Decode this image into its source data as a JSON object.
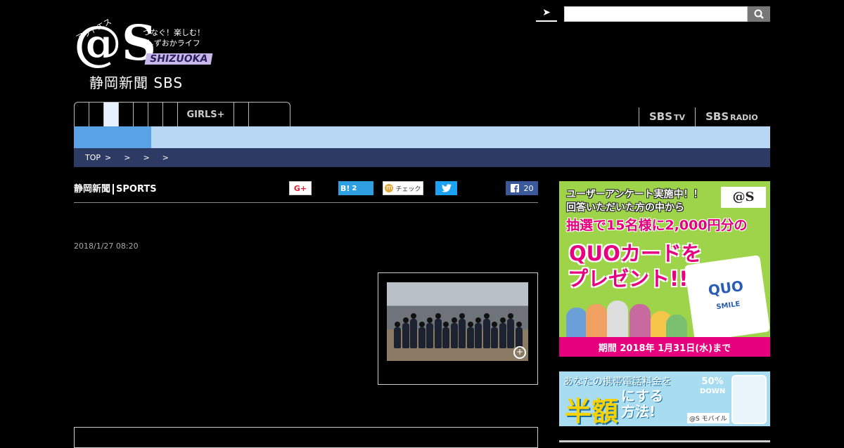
{
  "logo": {
    "kana": "アットエス",
    "mark": "@S",
    "tagline1": "つなぐ！楽しむ！",
    "tagline2": "しずおかライフ",
    "region": "SHIZUOKA",
    "brand": "静岡新聞 SBS"
  },
  "search": {
    "go_icon": "arrow-right-icon",
    "value": "",
    "button_icon": "search-icon"
  },
  "nav": {
    "tabs": [
      "",
      "",
      "",
      "",
      "",
      "",
      "",
      "GIRLS+",
      "",
      ""
    ],
    "active_index": 2
  },
  "external_links": [
    {
      "main": "SBS",
      "sub": "TV"
    },
    {
      "main": "SBS",
      "sub": "RADIO"
    }
  ],
  "breadcrumb": [
    "TOP",
    ">",
    ">",
    ">",
    ">"
  ],
  "article": {
    "source_logo": "静岡新聞",
    "source_section": "SPORTS",
    "date": "2018/1/27 08:20"
  },
  "share": {
    "gplus": "G+",
    "hatena": "B!",
    "hatena_count": "2",
    "mixi_icon": "m",
    "mixi": "チェック",
    "twitter_icon": "twitter-bird-icon",
    "facebook_icon": "facebook-icon",
    "facebook_count": "20"
  },
  "ad1": {
    "line1": "ユーザーアンケート実施中！！",
    "line2": "回答いただいた方の中から",
    "line3": "抽選で15名様に2,000円分の",
    "line4": "QUOカードを",
    "line5": "プレゼント!!",
    "card_brand": "QUO",
    "card_sub": "SMILE",
    "badge": "@S",
    "footer": "期間 2018年 1月31日(水)まで"
  },
  "ad2": {
    "line1": "あなたの携帯電話料金を",
    "big": "半額",
    "line2a": "にする",
    "line2b": "方法!",
    "pct": "50%",
    "pct_sub": "DOWN",
    "mobile": "@S モバイル"
  },
  "colors": {
    "nav_active": "#e8f1ff",
    "subbar": "#b8d7f5",
    "subbar_selected": "#5aa2e6",
    "breadcrumb_bg": "#2c3a64",
    "ad_green": "#9ed44a",
    "ad_pink": "#e6007e"
  }
}
